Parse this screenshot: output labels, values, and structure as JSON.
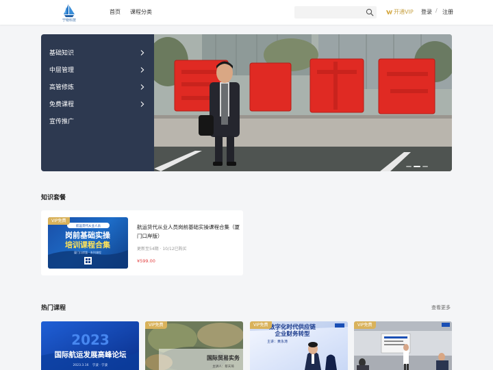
{
  "header": {
    "logo_text": "宁晓科技",
    "nav": [
      "首页",
      "课程分类"
    ],
    "search_placeholder": "",
    "vip_label": "开通VIP",
    "login_label": "登录",
    "separator": "/",
    "register_label": "注册"
  },
  "categories": [
    {
      "label": "基础知识",
      "has_arrow": true
    },
    {
      "label": "中层管理",
      "has_arrow": true
    },
    {
      "label": "高管修炼",
      "has_arrow": true
    },
    {
      "label": "免费课程",
      "has_arrow": true
    },
    {
      "label": "宣传推广",
      "has_arrow": false
    }
  ],
  "banner": {
    "sign_text": "富马拉雅"
  },
  "knowledge_section": {
    "title": "知识套餐",
    "package": {
      "badge": "VIP免费",
      "thumb_header": "航运货代从业人员",
      "thumb_title_1": "岗前基础实操",
      "thumb_title_2": "培训课程合集",
      "thumb_sub": "厦门口岸版 · 系列课程",
      "title": "航运货代从业人员岗前基础实操课程合集（厦门口岸版）",
      "meta": "更新至54期 · 10/12已购买",
      "price": "¥599.00"
    }
  },
  "hot_section": {
    "title": "热门课程",
    "more_label": "查看更多",
    "courses": [
      {
        "badge": "",
        "title_big": "2023",
        "title_main": "国际航运发展高峰论坛",
        "date": "2023.3.16",
        "place": "宁波 · 宁波"
      },
      {
        "badge": "VIP免费",
        "title_main": "国际贸易实务",
        "speaker": "主讲人：蔡天琦"
      },
      {
        "badge": "VIP免费",
        "title_main": "数字化时代供应链",
        "title_sub": "企业财务转型",
        "speaker": "主讲：黄永涛"
      },
      {
        "badge": "VIP免费"
      }
    ]
  },
  "colors": {
    "menu_bg": "#2d3950",
    "accent_vip": "#c7a245",
    "price": "#e23c3c",
    "sign_red": "#e02a23"
  }
}
